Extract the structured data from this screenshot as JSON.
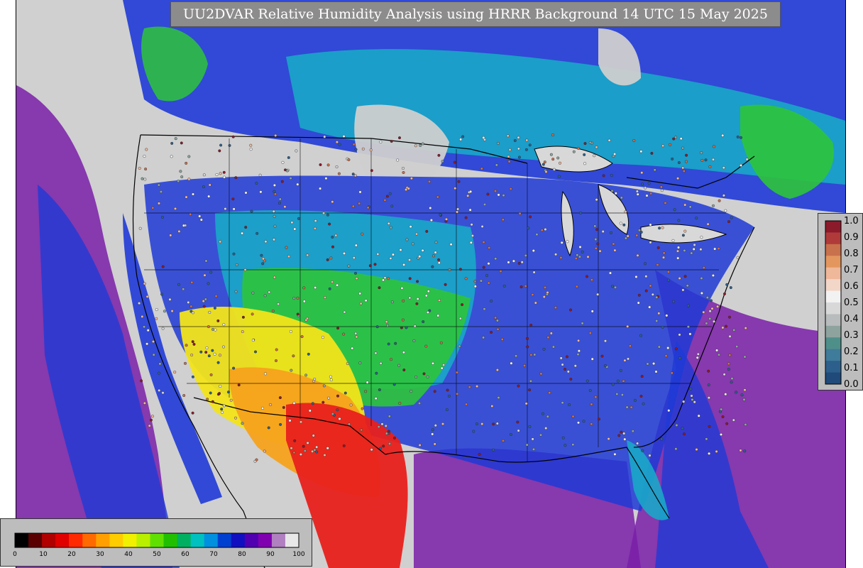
{
  "title": "UU2DVAR Relative Humidity Analysis using HRRR Background 14 UTC 15 May 2025",
  "observation_legend": {
    "labels": [
      "1.0",
      "0.9",
      "0.8",
      "0.7",
      "0.6",
      "0.5",
      "0.4",
      "0.3",
      "0.2",
      "0.1",
      "0.0"
    ],
    "colors": [
      "#8b1a2b",
      "#b03a3a",
      "#c9704d",
      "#e3975f",
      "#efb89a",
      "#f2d6c8",
      "#f2f2f2",
      "#d8d8d8",
      "#b8bcbc",
      "#8fa39e",
      "#4f8f8a",
      "#3f7b9a",
      "#2d5f8c",
      "#1f4a7a"
    ]
  },
  "colorbar": {
    "ticks": [
      "0",
      "10",
      "20",
      "30",
      "40",
      "50",
      "60",
      "70",
      "80",
      "90",
      "100"
    ],
    "colors": [
      "#000000",
      "#5a0000",
      "#b00000",
      "#e00000",
      "#ff2a00",
      "#ff6a00",
      "#ffa000",
      "#ffcc00",
      "#f0f000",
      "#b8f000",
      "#60e000",
      "#20c000",
      "#00b060",
      "#00c0c0",
      "#0090e0",
      "#0040d0",
      "#1010c0",
      "#5000b0",
      "#8000b0",
      "#b080c0",
      "#e8e8e8"
    ]
  },
  "map_colors": {
    "ocean_far": "#d0d0d0",
    "ocean_purple": "#7a1fa8",
    "ocean_blue": "#1f3ad6",
    "land_cyan": "#1aa7c8",
    "land_green": "#2ec43a",
    "land_yellow": "#f2e41a",
    "land_orange": "#f6a21c",
    "land_red": "#e8201c",
    "canada_gray": "#cfcfcf",
    "lakes": "#d8d8d8"
  }
}
